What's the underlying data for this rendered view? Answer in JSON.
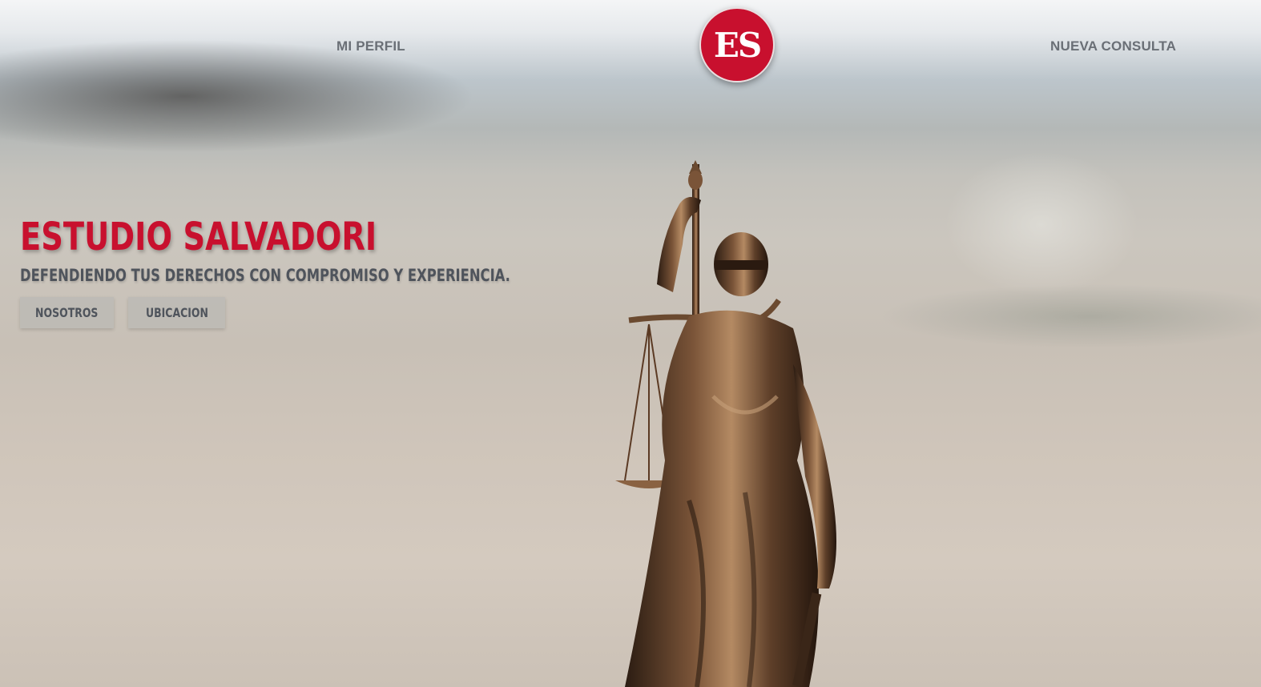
{
  "nav": {
    "profile_label": "MI PERFIL",
    "consult_label": "NUEVA CONSULTA",
    "logo_text": "ES"
  },
  "hero": {
    "title": "ESTUDIO SALVADORI",
    "subtitle": "DEFENDIENDO TUS DERECHOS CON COMPROMISO Y EXPERIENCIA.",
    "buttons": [
      "NOSOTROS",
      "UBICACION"
    ]
  },
  "colors": {
    "brand_red": "#c8102e",
    "nav_text": "#6a6f76",
    "subtitle_text": "#4f545c"
  }
}
